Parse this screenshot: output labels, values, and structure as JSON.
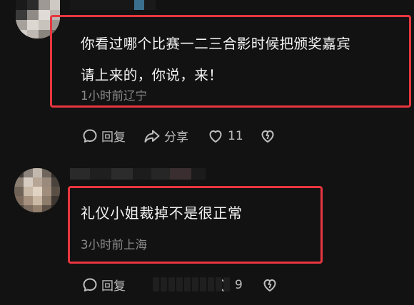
{
  "comments": [
    {
      "text_line1": "你看过哪个比赛一二三合影时候把颁奖嘉宾",
      "text_line2": "请上来的，你说，来！",
      "time": "1小时前",
      "location": "辽宁",
      "reply_label": "回复",
      "share_label": "分享",
      "like_count": "11",
      "avatar_icon": "pixelated-avatar",
      "highlight_color": "#e8363f"
    },
    {
      "text": "礼仪小姐裁掉不是很正常",
      "time": "3小时前",
      "location": "上海",
      "reply_label": "回复",
      "like_count": "9",
      "avatar_icon": "pixelated-avatar",
      "highlight_color": "#e8363f"
    }
  ],
  "colors": {
    "background": "#121212",
    "text_primary": "#f4f4f4",
    "text_secondary": "#8a8a8a",
    "icon": "#bdbdbd",
    "highlight": "#e8363f"
  }
}
